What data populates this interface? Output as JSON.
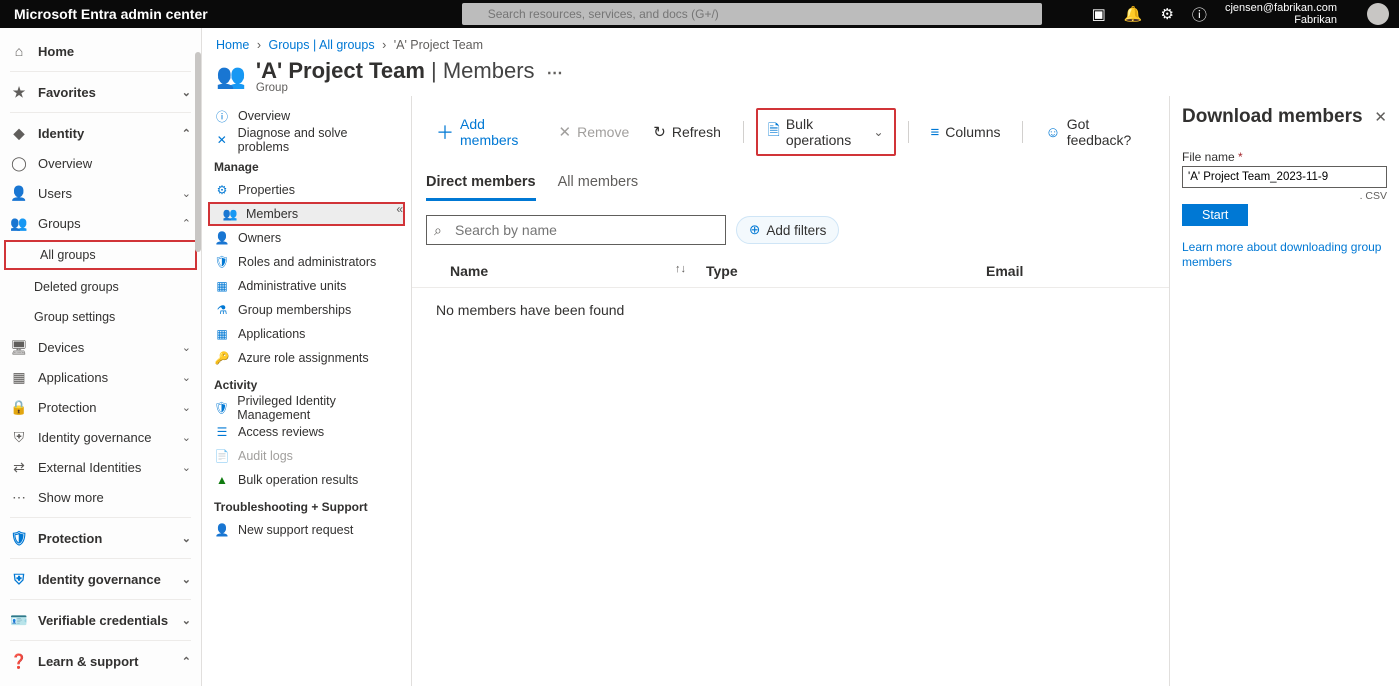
{
  "topbar": {
    "brand": "Microsoft Entra admin center",
    "search_placeholder": "Search resources, services, and docs (G+/)",
    "user_email": "cjensen@fabrikan.com",
    "tenant": "Fabrikan"
  },
  "leftnav": {
    "home": "Home",
    "favorites": "Favorites",
    "identity": "Identity",
    "overview": "Overview",
    "users": "Users",
    "groups": "Groups",
    "all_groups": "All groups",
    "deleted_groups": "Deleted groups",
    "group_settings": "Group settings",
    "devices": "Devices",
    "applications": "Applications",
    "protection": "Protection",
    "identity_governance": "Identity governance",
    "external_identities": "External Identities",
    "show_more": "Show more",
    "protection2": "Protection",
    "identity_governance2": "Identity governance",
    "verifiable": "Verifiable credentials",
    "learn": "Learn & support"
  },
  "resnav": {
    "overview": "Overview",
    "diagnose": "Diagnose and solve problems",
    "manage": "Manage",
    "properties": "Properties",
    "members": "Members",
    "owners": "Owners",
    "roles": "Roles and administrators",
    "admin_units": "Administrative units",
    "group_memberships": "Group memberships",
    "applications": "Applications",
    "azure_role": "Azure role assignments",
    "activity": "Activity",
    "pim": "Privileged Identity Management",
    "access_reviews": "Access reviews",
    "audit_logs": "Audit logs",
    "bulk_results": "Bulk operation results",
    "troubleshooting": "Troubleshooting + Support",
    "new_support": "New support request"
  },
  "breadcrumb": {
    "home": "Home",
    "groups": "Groups | All groups",
    "current": "'A' Project Team"
  },
  "page": {
    "title_group": "'A' Project Team",
    "title_section": "Members",
    "subtitle": "Group"
  },
  "toolbar": {
    "add": "Add members",
    "remove": "Remove",
    "refresh": "Refresh",
    "bulk": "Bulk operations",
    "columns": "Columns",
    "feedback": "Got feedback?"
  },
  "tabs": {
    "direct": "Direct members",
    "all": "All members"
  },
  "search": {
    "placeholder": "Search by name",
    "add_filters": "Add filters"
  },
  "table": {
    "name": "Name",
    "type": "Type",
    "email": "Email",
    "empty": "No members have been found"
  },
  "panel": {
    "title": "Download members",
    "file_label": "File name",
    "file_value": "'A' Project Team_2023-11-9",
    "ext": ". CSV",
    "start": "Start",
    "link": "Learn more about downloading group members"
  }
}
